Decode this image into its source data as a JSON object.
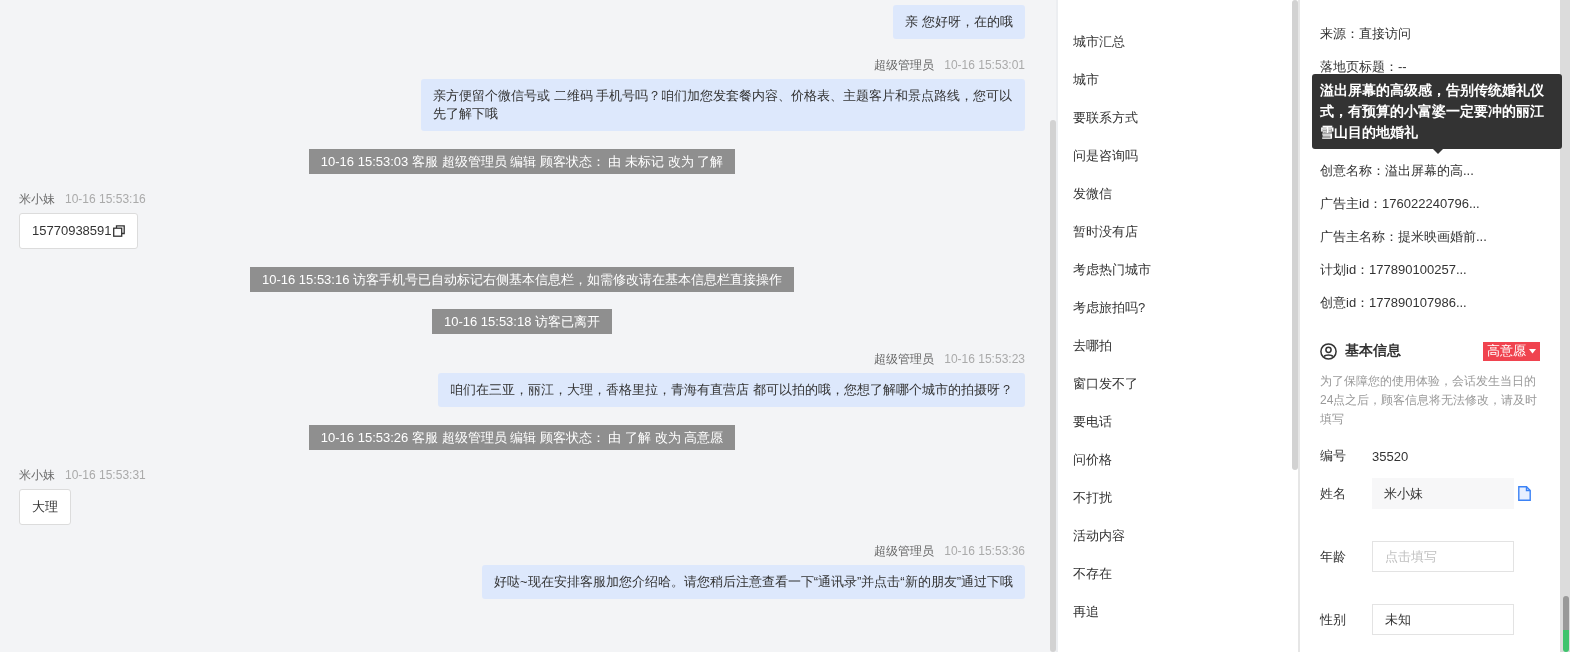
{
  "chat": {
    "messages": [
      {
        "kind": "agent",
        "text": "亲 您好呀，在的哦"
      },
      {
        "kind": "agent",
        "sender": "超级管理员",
        "time": "10-16 15:53:01",
        "text": "亲方便留个微信号或 二维码 手机号吗？咱们加您发套餐内容、价格表、主题客片和景点路线，您可以先了解下哦"
      },
      {
        "kind": "system",
        "text": "10-16 15:53:03 客服 超级管理员 编辑 顾客状态： 由 未标记 改为 了解"
      },
      {
        "kind": "visitor",
        "sender": "米小妹",
        "time": "10-16 15:53:16",
        "text": "15770938591",
        "copyable": true
      },
      {
        "kind": "system",
        "text": "10-16 15:53:16 访客手机号已自动标记右侧基本信息栏，如需修改请在基本信息栏直接操作"
      },
      {
        "kind": "system",
        "text": "10-16 15:53:18 访客已离开"
      },
      {
        "kind": "agent",
        "sender": "超级管理员",
        "time": "10-16 15:53:23",
        "text": "咱们在三亚，丽江，大理，香格里拉，青海有直营店 都可以拍的哦，您想了解哪个城市的拍摄呀？"
      },
      {
        "kind": "system",
        "text": "10-16 15:53:26 客服 超级管理员 编辑 顾客状态： 由 了解 改为 高意愿"
      },
      {
        "kind": "visitor",
        "sender": "米小妹",
        "time": "10-16 15:53:31",
        "text": "大理",
        "copyable": false
      },
      {
        "kind": "agent",
        "sender": "超级管理员",
        "time": "10-16 15:53:36",
        "text": "好哒~现在安排客服加您介绍哈。请您稍后注意查看一下“通讯录”并点击“新的朋友”通过下哦"
      }
    ]
  },
  "quick_replies": [
    "城市汇总",
    "城市",
    "要联系方式",
    "问是咨询吗",
    "发微信",
    "暂时没有店",
    "考虑热门城市",
    "考虑旅拍吗?",
    "去哪拍",
    "窗口发不了",
    "要电话",
    "问价格",
    "不打扰",
    "活动内容",
    "不存在",
    "再追"
  ],
  "source_info": {
    "items_above": [
      "来源：直接访问",
      "落地页标题：--"
    ],
    "tooltip": "溢出屏幕的高级感，告别传统婚礼仪式，有预算的小富婆一定要冲的丽江雪山目的地婚礼",
    "items_below": [
      "创意名称：溢出屏幕的高...",
      "广告主id：176022240796...",
      "广告主名称：提米映画婚前...",
      "计划id：177890100257...",
      "创意id：177890107986..."
    ]
  },
  "basic_info": {
    "title": "基本信息",
    "intent_tag": "高意愿",
    "note": "为了保障您的使用体验，会话发生当日的24点之后，顾客信息将无法修改，请及时填写",
    "fields": [
      {
        "kind": "text",
        "label": "编号",
        "value": "35520"
      },
      {
        "kind": "readonly",
        "label": "姓名",
        "value": "米小妹"
      },
      {
        "kind": "input",
        "label": "年龄",
        "placeholder": "点击填写"
      },
      {
        "kind": "input",
        "label": "性别",
        "value": "未知"
      }
    ]
  }
}
